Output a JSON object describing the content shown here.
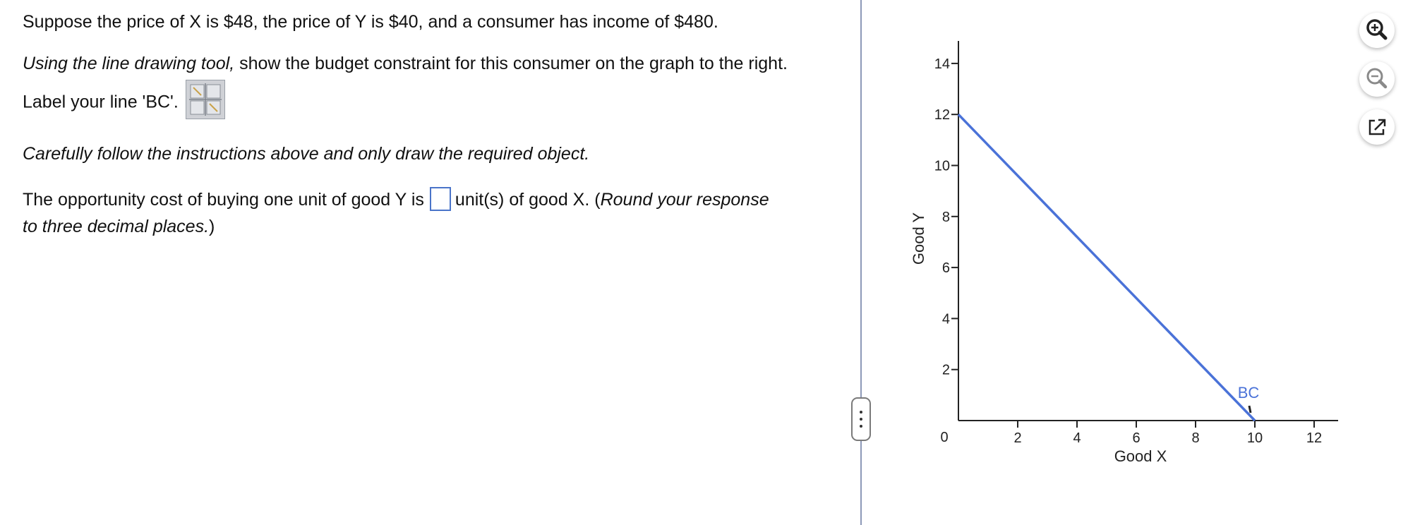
{
  "question": {
    "line1": "Suppose the price of X is $48, the price of Y is $40, and a consumer has income of $480.",
    "line2_italic": "Using the line drawing tool,",
    "line2_rest": " show the budget constraint for this consumer on the graph to the right.",
    "line3": "Label your line 'BC'.",
    "line4": "Carefully follow the instructions above and only draw the required object.",
    "line5_before": "The opportunity cost of buying one unit of good Y is",
    "line5_after": "unit(s) of good X. (",
    "line5_italic": "Round your response",
    "line6_italic": "to three decimal places.",
    "line6_end": ")",
    "answer_value": ""
  },
  "tool": {
    "icon": "line-drawing-tool-icon"
  },
  "graph": {
    "xlabel": "Good X",
    "ylabel": "Good Y",
    "x_ticks": [
      0,
      2,
      4,
      6,
      8,
      10,
      12
    ],
    "y_ticks": [
      2,
      4,
      6,
      8,
      10,
      12,
      14
    ],
    "xlim": [
      0,
      13.5
    ],
    "ylim": [
      0,
      15
    ],
    "line_color": "#4a72d8",
    "line": {
      "label": "BC",
      "x": [
        0,
        10
      ],
      "y": [
        12,
        0
      ]
    }
  },
  "side_buttons": [
    {
      "name": "zoom-in-button",
      "icon": "zoom-in-icon"
    },
    {
      "name": "zoom-out-button",
      "icon": "zoom-out-icon"
    },
    {
      "name": "popout-button",
      "icon": "popout-icon"
    }
  ]
}
